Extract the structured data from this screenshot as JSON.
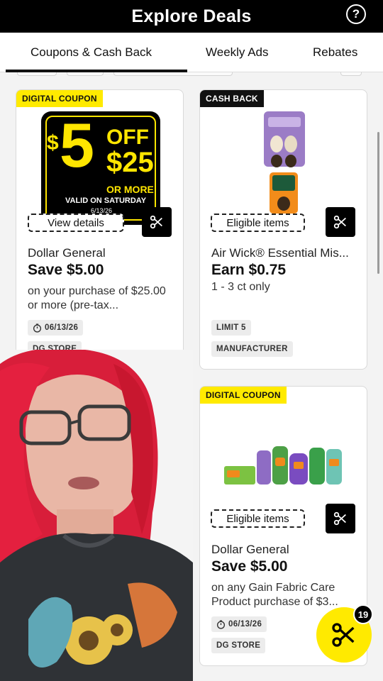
{
  "header": {
    "title": "Explore Deals",
    "help_icon": "?"
  },
  "tabs": [
    {
      "label": "Coupons & Cash Back",
      "active": true
    },
    {
      "label": "Weekly Ads",
      "active": false
    },
    {
      "label": "Rebates",
      "active": false
    }
  ],
  "cards": [
    {
      "tag": "DIGITAL COUPON",
      "art": {
        "big": "5",
        "dollar": "$",
        "off": "OFF",
        "amount": "$25",
        "more": "OR MORE",
        "valid": "VALID ON SATURDAY",
        "date": "6/13/26"
      },
      "action_label": "View details",
      "brand": "Dollar General",
      "amount": "Save $5.00",
      "desc": "on your purchase of $25.00 or more (pre-tax...",
      "chips": [
        "06/13/26",
        "DG STORE"
      ]
    },
    {
      "tag": "CASH BACK",
      "action_label": "Eligible items",
      "brand": "Air Wick® Essential Mis...",
      "amount": "Earn $0.75",
      "desc": "1 - 3 ct only",
      "chips": [
        "LIMIT 5",
        "MANUFACTURER"
      ]
    },
    {
      "tag": "DIGITAL COUPON",
      "action_label": "Eligible items",
      "brand": "Dollar General",
      "amount": "Save $5.00",
      "desc": "on any Gain Fabric Care Product purchase of $3...",
      "chips": [
        "06/13/26",
        "DG STORE"
      ]
    }
  ],
  "clip_counter": "19",
  "colors": {
    "accent_yellow": "#ffea00",
    "black": "#000000",
    "hair_red": "#e4203f"
  }
}
